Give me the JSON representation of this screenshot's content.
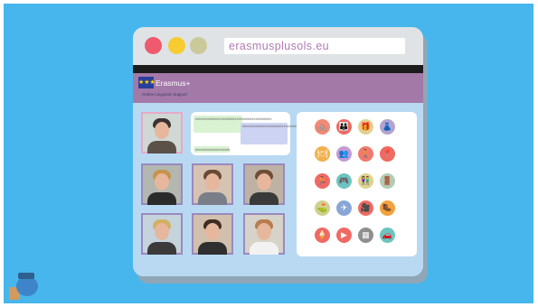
{
  "browser": {
    "url": "erasmusplusols.eu",
    "window_controls": [
      "close",
      "minimize",
      "maximize"
    ]
  },
  "banner": {
    "flag_stars": "★★★",
    "brand": "Erasmus+",
    "subtitle": "Online Linguistic Support"
  },
  "chat": {
    "messages": [
      "hhhhhhhhhhhhhhhhhhhhhhhhhhhhhhhhhhhhhhhh",
      "hhhhhhhhhhhhhhhhhhhhhhhhhhhhhhhhhhhhhhhhh",
      "hhhhhhhhhhhhhhhhhh"
    ]
  },
  "participants": [
    {
      "name": "participant-1",
      "bg": "#cfd8d4",
      "hair": "#3a3230",
      "shirt": "#5b5149"
    },
    {
      "name": "participant-2",
      "bg": "#b2b7b0",
      "hair": "#c8934d",
      "shirt": "#2b2b2b"
    },
    {
      "name": "participant-3",
      "bg": "#d6c3b3",
      "hair": "#6a4a34",
      "shirt": "#7a7e88"
    },
    {
      "name": "participant-4",
      "bg": "#bdb2a4",
      "hair": "#6e4d35",
      "shirt": "#3a3a3a"
    },
    {
      "name": "participant-5",
      "bg": "#c5d3dd",
      "hair": "#d3b063",
      "shirt": "#3b3b3b"
    },
    {
      "name": "participant-6",
      "bg": "#d0c0ad",
      "hair": "#3f2c22",
      "shirt": "#2f2f2f"
    },
    {
      "name": "participant-7",
      "bg": "#d8d3c8",
      "hair": "#b77c50",
      "shirt": "#f2f2f2"
    }
  ],
  "topic_icons": [
    {
      "name": "cycling-icon",
      "color": "#f08a76",
      "glyph": "🚲"
    },
    {
      "name": "family-icon",
      "color": "#ef6a63",
      "glyph": "👪"
    },
    {
      "name": "gifts-icon",
      "color": "#e3d08f",
      "glyph": "🎁"
    },
    {
      "name": "dress-icon",
      "color": "#b3a3cf",
      "glyph": "👗"
    },
    {
      "name": "restaurant-icon",
      "color": "#f1b14c",
      "glyph": "🍽"
    },
    {
      "name": "people-icon",
      "color": "#c39bd3",
      "glyph": "👥"
    },
    {
      "name": "walking-icon",
      "color": "#f07a6e",
      "glyph": "🚶"
    },
    {
      "name": "location-icon",
      "color": "#ef6a63",
      "glyph": "📍"
    },
    {
      "name": "running-icon",
      "color": "#ef6a63",
      "glyph": "🏃"
    },
    {
      "name": "gamepad-icon",
      "color": "#6dc4c0",
      "glyph": "🎮"
    },
    {
      "name": "couple-icon",
      "color": "#dfd28e",
      "glyph": "👫"
    },
    {
      "name": "door-icon",
      "color": "#b3cbb3",
      "glyph": "🚪"
    },
    {
      "name": "golf-icon",
      "color": "#cfd08c",
      "glyph": "⛳"
    },
    {
      "name": "plane-icon",
      "color": "#8aa6d6",
      "glyph": "✈"
    },
    {
      "name": "camera-icon",
      "color": "#ef6a63",
      "glyph": "🎥"
    },
    {
      "name": "hiking-icon",
      "color": "#f3a13e",
      "glyph": "🥾"
    },
    {
      "name": "ice-cream-icon",
      "color": "#ef6a63",
      "glyph": "🍦"
    },
    {
      "name": "video-icon",
      "color": "#ef6a63",
      "glyph": "▶"
    },
    {
      "name": "calendar-icon",
      "color": "#8f8f8f",
      "glyph": "▦"
    },
    {
      "name": "car-icon",
      "color": "#6dc4c0",
      "glyph": "🚗"
    }
  ]
}
